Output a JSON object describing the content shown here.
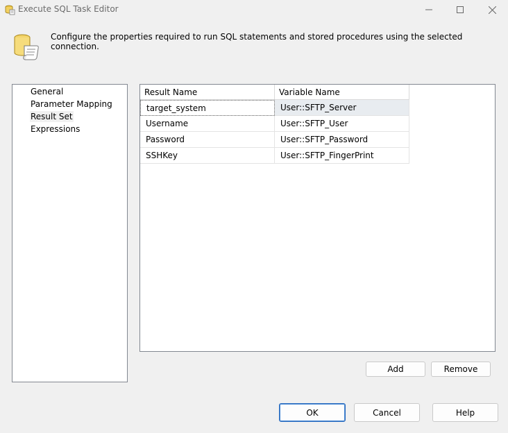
{
  "window": {
    "title": "Execute SQL Task Editor",
    "icon": "execute-sql-task-icon",
    "controls": [
      "minimize-icon",
      "maximize-icon",
      "close-icon"
    ]
  },
  "header": {
    "icon": "database-scroll-icon",
    "description": "Configure the properties required to run SQL statements and stored procedures using the selected connection."
  },
  "nav": {
    "items": [
      {
        "label": "General"
      },
      {
        "label": "Parameter Mapping"
      },
      {
        "label": "Result Set"
      },
      {
        "label": "Expressions"
      }
    ],
    "selected": "Result Set"
  },
  "grid": {
    "columns": [
      "Result Name",
      "Variable Name"
    ],
    "rows": [
      [
        "target_system",
        "User::SFTP_Server"
      ],
      [
        "Username",
        "User::SFTP_User"
      ],
      [
        "Password",
        "User::SFTP_Password"
      ],
      [
        "SSHKey",
        "User::SFTP_FingerPrint"
      ]
    ],
    "selected_row": 0
  },
  "grid_buttons": {
    "add": "Add",
    "remove": "Remove"
  },
  "footer_buttons": {
    "ok": "OK",
    "cancel": "Cancel",
    "help": "Help"
  },
  "colors": {
    "accent": "#2b6cbf",
    "selected_row": "#e8ecf0"
  }
}
